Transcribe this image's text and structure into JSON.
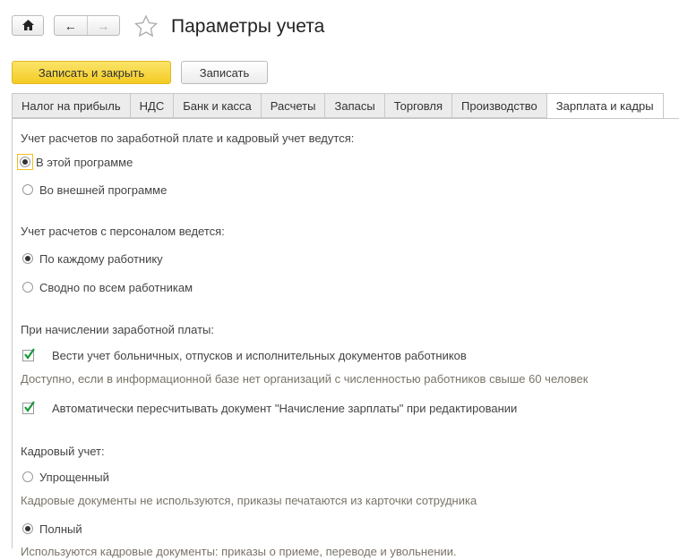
{
  "header": {
    "title": "Параметры учета",
    "icons": [
      "home-icon",
      "arrow-left-icon",
      "arrow-right-icon",
      "star-icon"
    ]
  },
  "toolbar": {
    "save_close": "Записать и закрыть",
    "save": "Записать",
    "accent": "#f7d23a"
  },
  "tabs": [
    {
      "label": "Налог на прибыль"
    },
    {
      "label": "НДС"
    },
    {
      "label": "Банк и касса"
    },
    {
      "label": "Расчеты"
    },
    {
      "label": "Запасы"
    },
    {
      "label": "Торговля"
    },
    {
      "label": "Производство"
    },
    {
      "label": "Зарплата и кадры",
      "active": true
    }
  ],
  "content": {
    "salary_label": "Учет расчетов по заработной плате и кадровый учет ведутся:",
    "salary_opt1": "В этой программе",
    "salary_opt2": "Во внешней программе",
    "personnel_label": "Учет расчетов с персоналом ведется:",
    "personnel_opt1": "По каждому работнику",
    "personnel_opt2": "Сводно по всем работникам",
    "accrual_label": "При начислении заработной платы:",
    "check1": "Вести учет больничных, отпусков и исполнительных документов работников",
    "check1_hint": "Доступно, если в информационной базе нет организаций с численностью работников свыше 60 человек",
    "check2": "Автоматически пересчитывать документ \"Начисление зарплаты\" при редактировании",
    "hr_label": "Кадровый учет:",
    "hr_opt1": "Упрощенный",
    "hr_opt1_hint": "Кадровые документы не используются, приказы печатаются из карточки сотрудника",
    "hr_opt2": "Полный",
    "hr_opt2_hint": "Используются кадровые документы: приказы о приеме, переводе и увольнении."
  }
}
